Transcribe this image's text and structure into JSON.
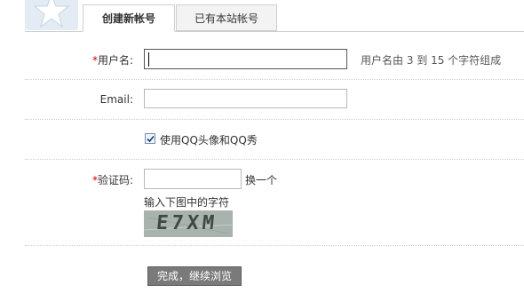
{
  "tabs": {
    "create_account": "创建新帐号",
    "existing_account": "已有本站帐号"
  },
  "form": {
    "username": {
      "required_mark": "*",
      "label": "用户名:",
      "value": "",
      "hint": "用户名由 3 到 15 个字符组成"
    },
    "email": {
      "label": "Email:",
      "value": ""
    },
    "qq_option": {
      "checked": true,
      "label": "使用QQ头像和QQ秀"
    },
    "captcha": {
      "required_mark": "*",
      "label": "验证码:",
      "value": "",
      "refresh_link": "换一个",
      "instruction": "输入下图中的字符",
      "image_text": "E7XM"
    },
    "submit_label": "完成，继续浏览"
  },
  "colors": {
    "required": "#cc0000",
    "button_bg": "#7a7a7a",
    "captcha_bg": "#a9b3ae"
  }
}
